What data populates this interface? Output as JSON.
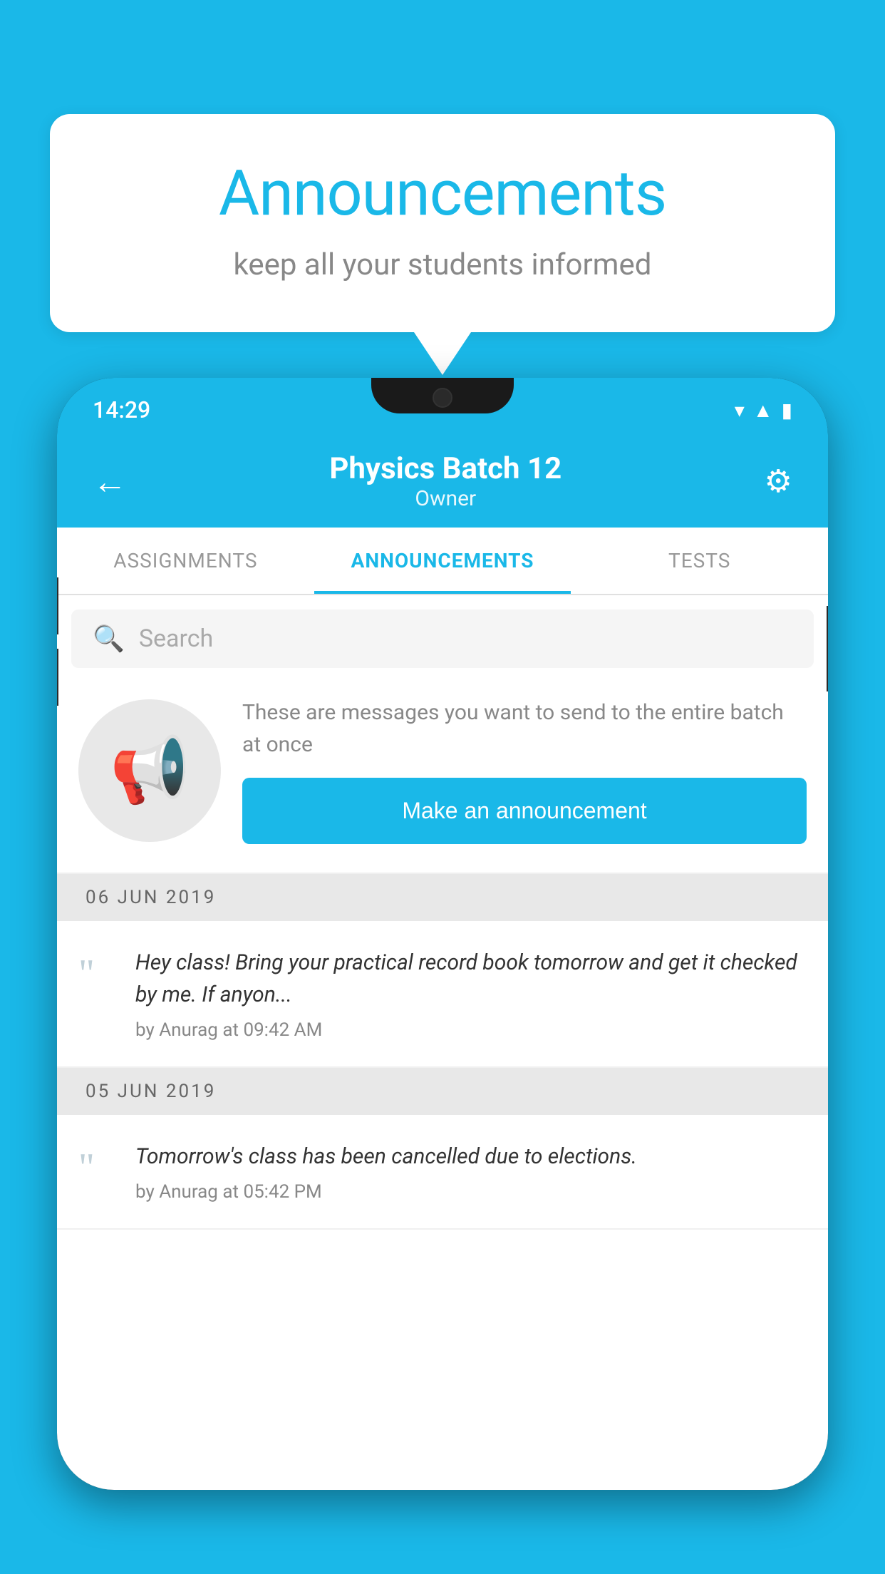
{
  "background_color": "#1ab8e8",
  "speech_bubble": {
    "title": "Announcements",
    "subtitle": "keep all your students informed"
  },
  "status_bar": {
    "time": "14:29"
  },
  "app_bar": {
    "back_icon": "←",
    "title": "Physics Batch 12",
    "subtitle": "Owner",
    "settings_icon": "⚙"
  },
  "tabs": [
    {
      "label": "ASSIGNMENTS",
      "active": false
    },
    {
      "label": "ANNOUNCEMENTS",
      "active": true
    },
    {
      "label": "TESTS",
      "active": false
    }
  ],
  "search": {
    "placeholder": "Search"
  },
  "announcement_promo": {
    "description_text": "These are messages you want to send to the entire batch at once",
    "button_label": "Make an announcement"
  },
  "announcements": [
    {
      "date": "06  JUN  2019",
      "text": "Hey class! Bring your practical record book tomorrow and get it checked by me. If anyon...",
      "meta": "by Anurag at 09:42 AM"
    },
    {
      "date": "05  JUN  2019",
      "text": "Tomorrow's class has been cancelled due to elections.",
      "meta": "by Anurag at 05:42 PM"
    }
  ]
}
